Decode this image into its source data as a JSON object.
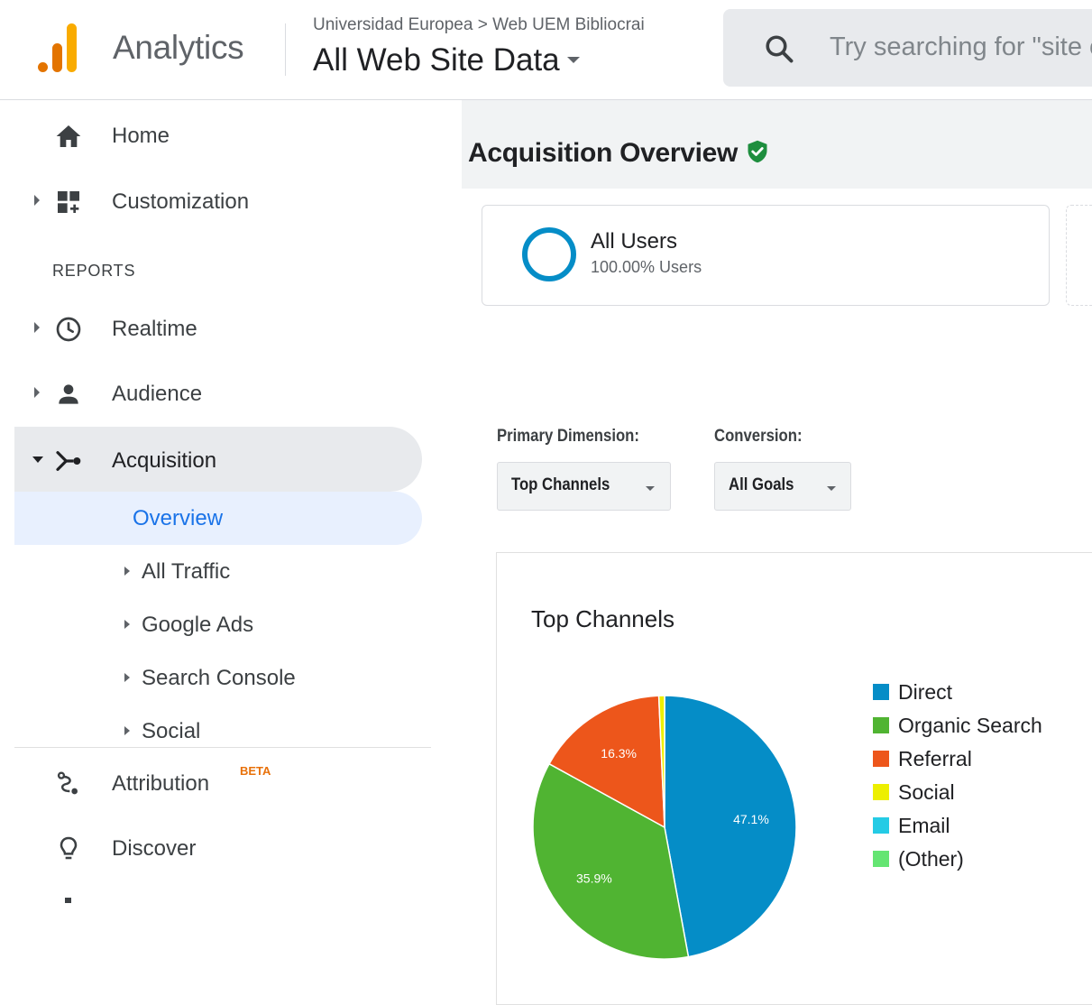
{
  "header": {
    "app_name": "Analytics",
    "breadcrumb": "Universidad Europea > Web UEM Bibliocrai",
    "property": "All Web Site Data",
    "search_placeholder": "Try searching for \"site content\"",
    "logo_colors": [
      "#f9ab00",
      "#e37400",
      "#e37400"
    ]
  },
  "sidebar": {
    "home": "Home",
    "customization": "Customization",
    "reports_section": "REPORTS",
    "realtime": "Realtime",
    "audience": "Audience",
    "acquisition": "Acquisition",
    "acquisition_children": {
      "overview": "Overview",
      "all_traffic": "All Traffic",
      "google_ads": "Google Ads",
      "search_console": "Search Console",
      "social": "Social"
    },
    "attribution": "Attribution",
    "attribution_badge": "BETA",
    "discover": "Discover"
  },
  "main": {
    "page_title": "Acquisition Overview",
    "segment": {
      "name": "All Users",
      "subtitle": "100.00% Users"
    },
    "primary_dimension_label": "Primary Dimension:",
    "primary_dimension_value": "Top Channels",
    "conversion_label": "Conversion:",
    "conversion_value": "All Goals"
  },
  "chart_data": {
    "type": "pie",
    "title": "Top Channels",
    "categories": [
      "Direct",
      "Organic Search",
      "Referral",
      "Social",
      "Email",
      "(Other)"
    ],
    "values": [
      47.1,
      35.9,
      16.3,
      0.7,
      0,
      0
    ],
    "labels": [
      "47.1%",
      "35.9%",
      "16.3%",
      "",
      "",
      ""
    ],
    "colors": [
      "#058dc7",
      "#50b432",
      "#ed561b",
      "#edef00",
      "#24cbe5",
      "#64e572"
    ],
    "legend_position": "right"
  }
}
